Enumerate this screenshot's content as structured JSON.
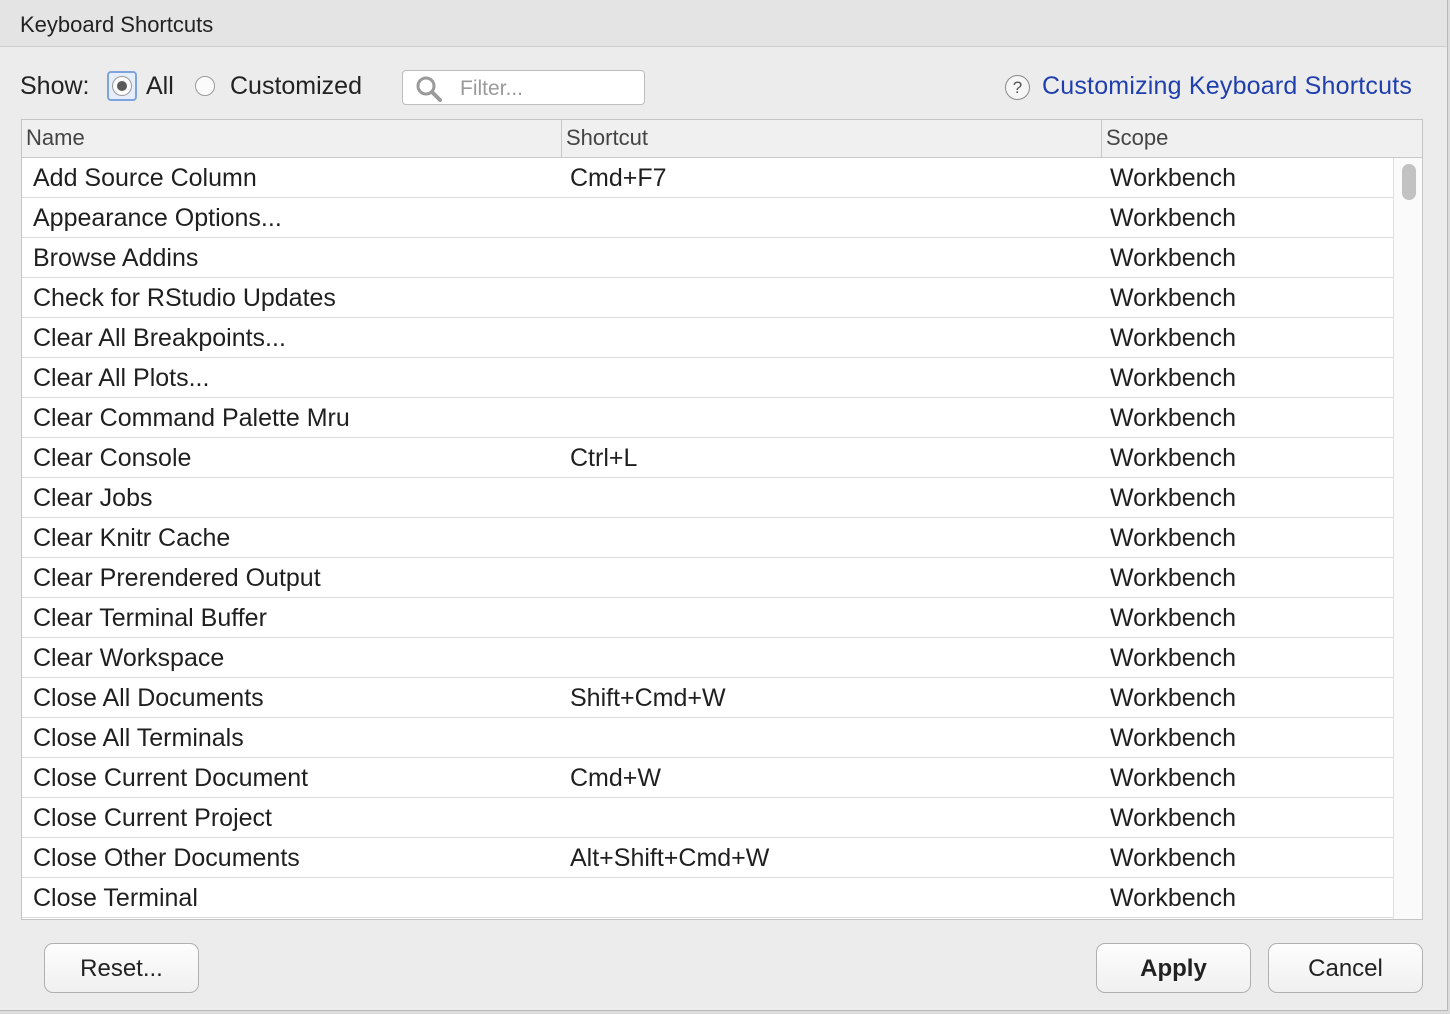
{
  "window": {
    "title": "Keyboard Shortcuts"
  },
  "toolbar": {
    "show_label": "Show:",
    "options": [
      {
        "label": "All",
        "selected": true
      },
      {
        "label": "Customized",
        "selected": false
      }
    ],
    "filter": {
      "placeholder": "Filter...",
      "value": ""
    },
    "help_icon_glyph": "?",
    "help_link": "Customizing Keyboard Shortcuts"
  },
  "table": {
    "columns": [
      "Name",
      "Shortcut",
      "Scope"
    ],
    "rows": [
      {
        "name": "Add Source Column",
        "shortcut": "Cmd+F7",
        "scope": "Workbench"
      },
      {
        "name": "Appearance Options...",
        "shortcut": "",
        "scope": "Workbench"
      },
      {
        "name": "Browse Addins",
        "shortcut": "",
        "scope": "Workbench"
      },
      {
        "name": "Check for RStudio Updates",
        "shortcut": "",
        "scope": "Workbench"
      },
      {
        "name": "Clear All Breakpoints...",
        "shortcut": "",
        "scope": "Workbench"
      },
      {
        "name": "Clear All Plots...",
        "shortcut": "",
        "scope": "Workbench"
      },
      {
        "name": "Clear Command Palette Mru",
        "shortcut": "",
        "scope": "Workbench"
      },
      {
        "name": "Clear Console",
        "shortcut": "Ctrl+L",
        "scope": "Workbench"
      },
      {
        "name": "Clear Jobs",
        "shortcut": "",
        "scope": "Workbench"
      },
      {
        "name": "Clear Knitr Cache",
        "shortcut": "",
        "scope": "Workbench"
      },
      {
        "name": "Clear Prerendered Output",
        "shortcut": "",
        "scope": "Workbench"
      },
      {
        "name": "Clear Terminal Buffer",
        "shortcut": "",
        "scope": "Workbench"
      },
      {
        "name": "Clear Workspace",
        "shortcut": "",
        "scope": "Workbench"
      },
      {
        "name": "Close All Documents",
        "shortcut": "Shift+Cmd+W",
        "scope": "Workbench"
      },
      {
        "name": "Close All Terminals",
        "shortcut": "",
        "scope": "Workbench"
      },
      {
        "name": "Close Current Document",
        "shortcut": "Cmd+W",
        "scope": "Workbench"
      },
      {
        "name": "Close Current Project",
        "shortcut": "",
        "scope": "Workbench"
      },
      {
        "name": "Close Other Documents",
        "shortcut": "Alt+Shift+Cmd+W",
        "scope": "Workbench"
      },
      {
        "name": "Close Terminal",
        "shortcut": "",
        "scope": "Workbench"
      }
    ]
  },
  "footer": {
    "reset_label": "Reset...",
    "apply_label": "Apply",
    "cancel_label": "Cancel"
  },
  "colors": {
    "link": "#1f3fae",
    "selection_focus": "#7fa4dd",
    "dialog_bg": "#ececec"
  },
  "icons": [
    "search-icon",
    "help-icon"
  ]
}
